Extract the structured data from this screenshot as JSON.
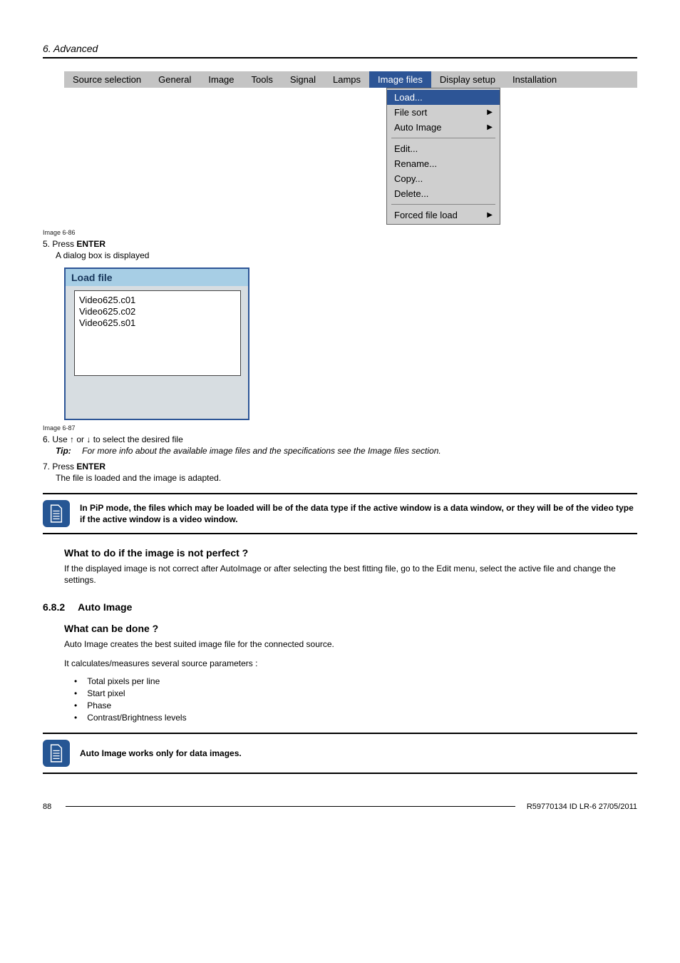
{
  "chapter": "6. Advanced",
  "menu": {
    "items": [
      "Source selection",
      "General",
      "Image",
      "Tools",
      "Signal",
      "Lamps",
      "Image files",
      "Display setup",
      "Installation"
    ],
    "active_index": 6
  },
  "dropdown": {
    "groups": [
      [
        {
          "label": "Load...",
          "submenu": false,
          "active": true
        },
        {
          "label": "File sort",
          "submenu": true,
          "active": false
        },
        {
          "label": "Auto Image",
          "submenu": true,
          "active": false
        }
      ],
      [
        {
          "label": "Edit...",
          "submenu": false,
          "active": false
        },
        {
          "label": "Rename...",
          "submenu": false,
          "active": false
        },
        {
          "label": "Copy...",
          "submenu": false,
          "active": false
        },
        {
          "label": "Delete...",
          "submenu": false,
          "active": false
        }
      ],
      [
        {
          "label": "Forced file load",
          "submenu": true,
          "active": false
        }
      ]
    ]
  },
  "captions": {
    "menu": "Image 6-86",
    "dialog": "Image 6-87"
  },
  "step5": {
    "line": "5.  Press ",
    "enter": "ENTER",
    "sub": "A dialog box is displayed"
  },
  "dialog": {
    "title": "Load file",
    "items": [
      "Video625.c01",
      "Video625.c02",
      "Video625.s01"
    ]
  },
  "step6": {
    "line": "6.  Use ↑ or ↓ to select the desired file",
    "tip_label": "Tip:",
    "tip_text": "For more info about the available image files and the specifications see the Image files section."
  },
  "step7": {
    "line": "7.  Press ",
    "enter": "ENTER",
    "after": "The file is loaded and the image is adapted."
  },
  "note1": "In PiP mode, the files which may be loaded will be of the data type if the active window is a data window, or they will be of the video type if the active window is a video window.",
  "what_heading": "What to do if the image is not perfect ?",
  "what_text": "If the displayed image is not correct after AutoImage or after selecting the best fitting file, go to the Edit menu, select the active file and change the settings.",
  "section": {
    "num": "6.8.2",
    "title": "Auto Image"
  },
  "canbe_heading": "What can be done ?",
  "canbe_p1": "Auto Image creates the best suited image file for the connected source.",
  "canbe_p2": "It calculates/measures several source parameters :",
  "bullets": [
    "Total pixels per line",
    "Start pixel",
    "Phase",
    "Contrast/Brightness levels"
  ],
  "note2": "Auto Image works only for data images.",
  "footer": {
    "page": "88",
    "ref": "R59770134  ID LR-6  27/05/2011"
  }
}
